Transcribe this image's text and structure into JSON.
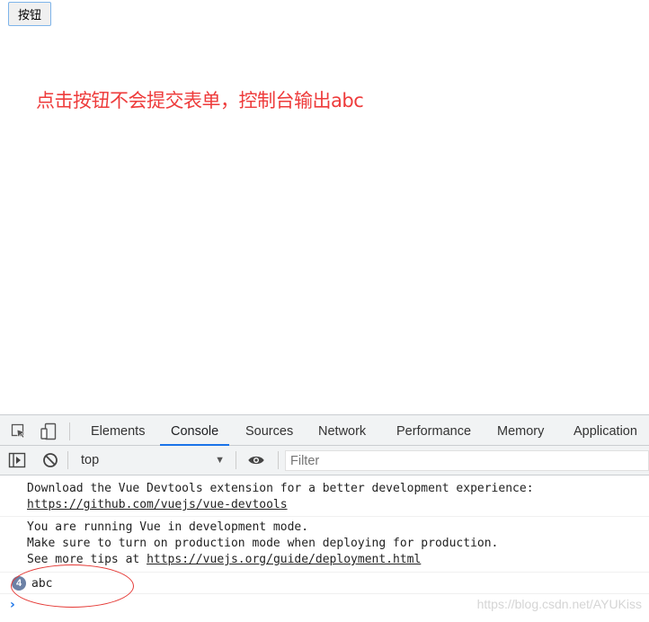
{
  "page": {
    "button_label": "按钮",
    "annotation": "点击按钮不会提交表单，控制台输出abc",
    "annotation_color": "#ee3b3b"
  },
  "devtools": {
    "icons": {
      "inspect": "inspect-element-icon",
      "device": "device-toolbar-icon",
      "sidebar": "console-sidebar-icon",
      "clear": "clear-console-icon",
      "eye": "live-expression-eye-icon"
    },
    "tabs": [
      {
        "label": "Elements",
        "active": false
      },
      {
        "label": "Console",
        "active": true
      },
      {
        "label": "Sources",
        "active": false
      },
      {
        "label": "Network",
        "active": false
      },
      {
        "label": "Performance",
        "active": false
      },
      {
        "label": "Memory",
        "active": false
      },
      {
        "label": "Application",
        "active": false
      }
    ],
    "accent_color": "#1a73e8",
    "toolbar": {
      "context": "top",
      "filter_placeholder": "Filter"
    }
  },
  "console": {
    "messages": [
      {
        "lines": [
          "Download the Vue Devtools extension for a better development experience:"
        ],
        "link": "https://github.com/vuejs/vue-devtools"
      },
      {
        "lines": [
          "You are running Vue in development mode.",
          "Make sure to turn on production mode when deploying for production."
        ],
        "tail_text": "See more tips at ",
        "link": "https://vuejs.org/guide/deployment.html"
      }
    ],
    "repeated_log": {
      "count": "4",
      "text": "abc"
    },
    "prompt_symbol": "›"
  },
  "watermark": "https://blog.csdn.net/AYUKiss"
}
